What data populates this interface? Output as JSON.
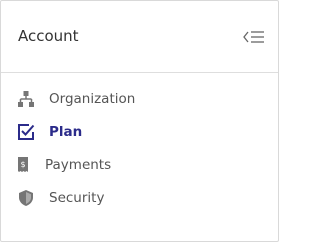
{
  "panel": {
    "title": "Account",
    "collapse_icon": "collapse-menu-icon"
  },
  "nav": {
    "items": [
      {
        "label": "Organization",
        "icon": "org-chart-icon",
        "active": false
      },
      {
        "label": "Plan",
        "icon": "checkbox-icon",
        "active": true
      },
      {
        "label": "Payments",
        "icon": "receipt-icon",
        "active": false
      },
      {
        "label": "Security",
        "icon": "shield-icon",
        "active": false
      }
    ]
  },
  "colors": {
    "active": "#2b2b8a",
    "icon": "#757575",
    "text": "#555555",
    "border": "#d9d9d9"
  }
}
